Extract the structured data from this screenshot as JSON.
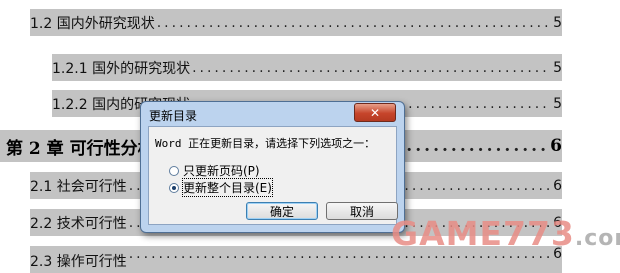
{
  "toc": [
    {
      "title": "1.2 国内外研究现状",
      "page": "5",
      "level": 2
    },
    {
      "title": "1.2.1 国外的研究现状",
      "page": "5",
      "level": 3
    },
    {
      "title": "1.2.2 国内的研究现状",
      "page": "5",
      "level": 3
    },
    {
      "title": "第 2 章  可行性分析",
      "page": "6",
      "level": 1
    },
    {
      "title": "2.1 社会可行性",
      "page": "6",
      "level": 2
    },
    {
      "title": "2.2 技术可行性",
      "page": "6",
      "level": 2
    },
    {
      "title": "2.3 操作可行性",
      "page": "6",
      "level": 2
    }
  ],
  "dialog": {
    "title": "更新目录",
    "close_glyph": "✕",
    "prompt": "Word 正在更新目录，请选择下列选项之一：",
    "options": [
      {
        "label": "只更新页码(P)",
        "checked": false
      },
      {
        "label": "更新整个目录(E)",
        "checked": true
      }
    ],
    "ok_label": "确定",
    "cancel_label": "取消"
  },
  "watermark": {
    "text": "GAME773",
    "domain": ".com"
  }
}
